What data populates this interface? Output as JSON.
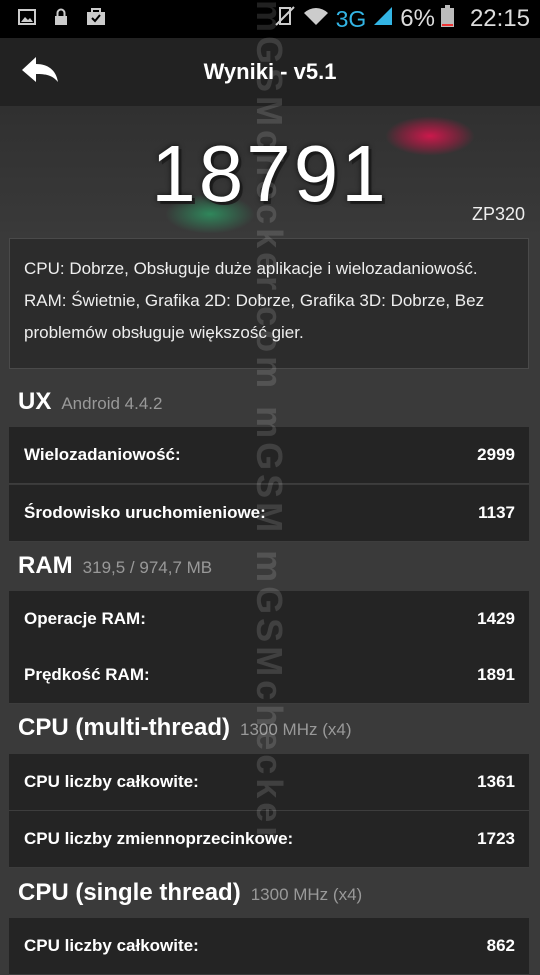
{
  "status_bar": {
    "signal": "3G",
    "battery": "6%",
    "time": "22:15"
  },
  "app_bar": {
    "title": "Wyniki - v5.1"
  },
  "hero": {
    "score": "18791",
    "device": "ZP320"
  },
  "summary": "CPU: Dobrze, Obsługuje duże aplikacje i wielozadaniowość. RAM: Świetnie, Grafika 2D: Dobrze, Grafika 3D: Dobrze, Bez problemów obsługuje większość gier.",
  "sections": [
    {
      "title": "UX",
      "subtitle": "Android 4.4.2",
      "rows": [
        {
          "label": "Wielozadaniowość:",
          "value": "2999"
        },
        {
          "label": "Środowisko uruchomieniowe:",
          "value": "1137"
        }
      ]
    },
    {
      "title": "RAM",
      "subtitle": "319,5 / 974,7 MB",
      "rows": [
        {
          "label": "Operacje RAM:",
          "value": "1429"
        },
        {
          "label": "Prędkość RAM:",
          "value": "1891"
        }
      ]
    },
    {
      "title": "CPU (multi-thread)",
      "subtitle": "1300 MHz (x4)",
      "rows": [
        {
          "label": "CPU liczby całkowite:",
          "value": "1361"
        },
        {
          "label": "CPU liczby zmiennoprzecinkowe:",
          "value": "1723"
        }
      ]
    },
    {
      "title": "CPU (single thread)",
      "subtitle": "1300 MHz (x4)",
      "rows": [
        {
          "label": "CPU liczby całkowite:",
          "value": "862"
        }
      ]
    }
  ],
  "watermark": "mGSMchecker.com mGSM mGSMchecker"
}
